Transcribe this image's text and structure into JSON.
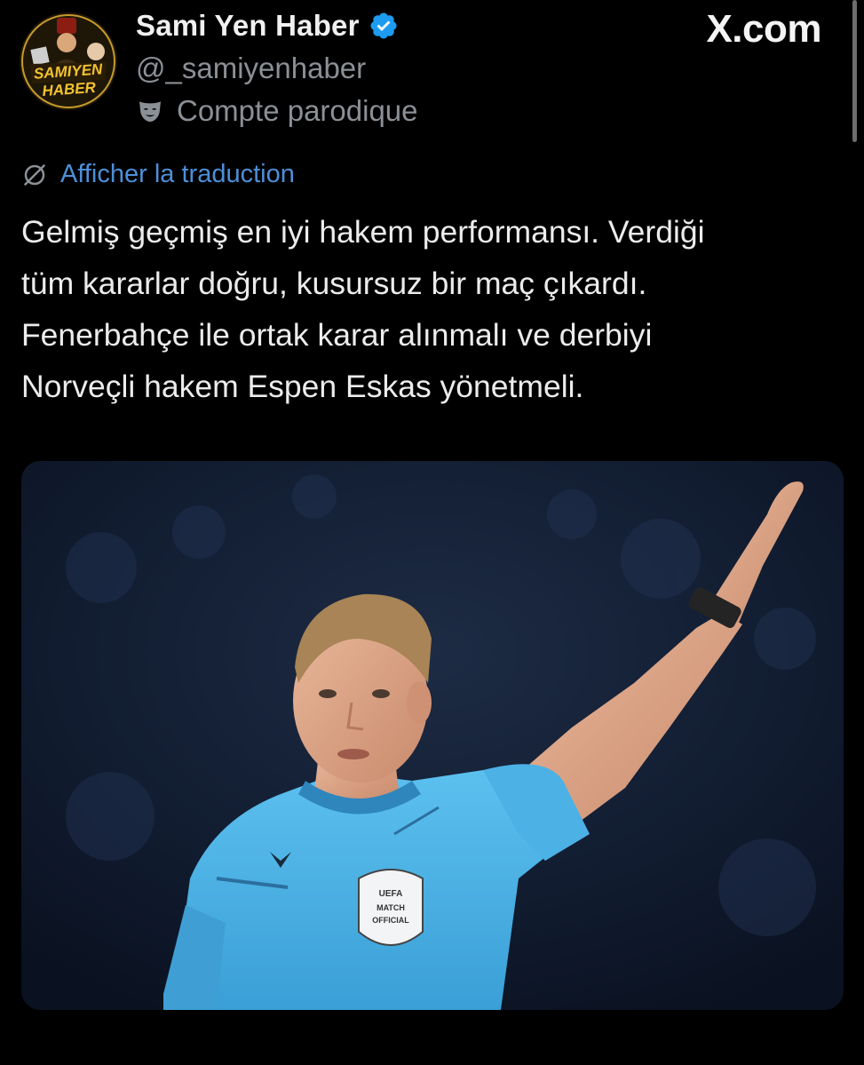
{
  "source": {
    "logo_text": "X.com"
  },
  "author": {
    "display_name": "Sami Yen Haber",
    "handle": "@_samiyenhaber",
    "account_label": "Compte parodique",
    "verified": true,
    "avatar_text_line1": "SAMIYEN",
    "avatar_text_line2": "HABER"
  },
  "translation": {
    "link_label": "Afficher la traduction"
  },
  "tweet": {
    "text": "Gelmiş geçmiş en iyi hakem performansı. Verdiği\ntüm kararlar doğru, kusursuz bir maç çıkardı.\nFenerbahçe ile ortak karar alınmalı ve derbiyi\nNorveçli hakem Espen Eskas yönetmeli."
  },
  "media": {
    "badge_line1": "UEFA",
    "badge_line2": "MATCH",
    "badge_line3": "OFFICIAL"
  },
  "colors": {
    "background": "#000000",
    "text_primary": "#e7e9ea",
    "text_secondary": "#8b9096",
    "link": "#4d8fd9",
    "verified": "#1d9bf0",
    "jersey": "#4fb3e6"
  },
  "icons": [
    "verified-badge-icon",
    "parody-mask-icon",
    "translate-globe-icon"
  ]
}
